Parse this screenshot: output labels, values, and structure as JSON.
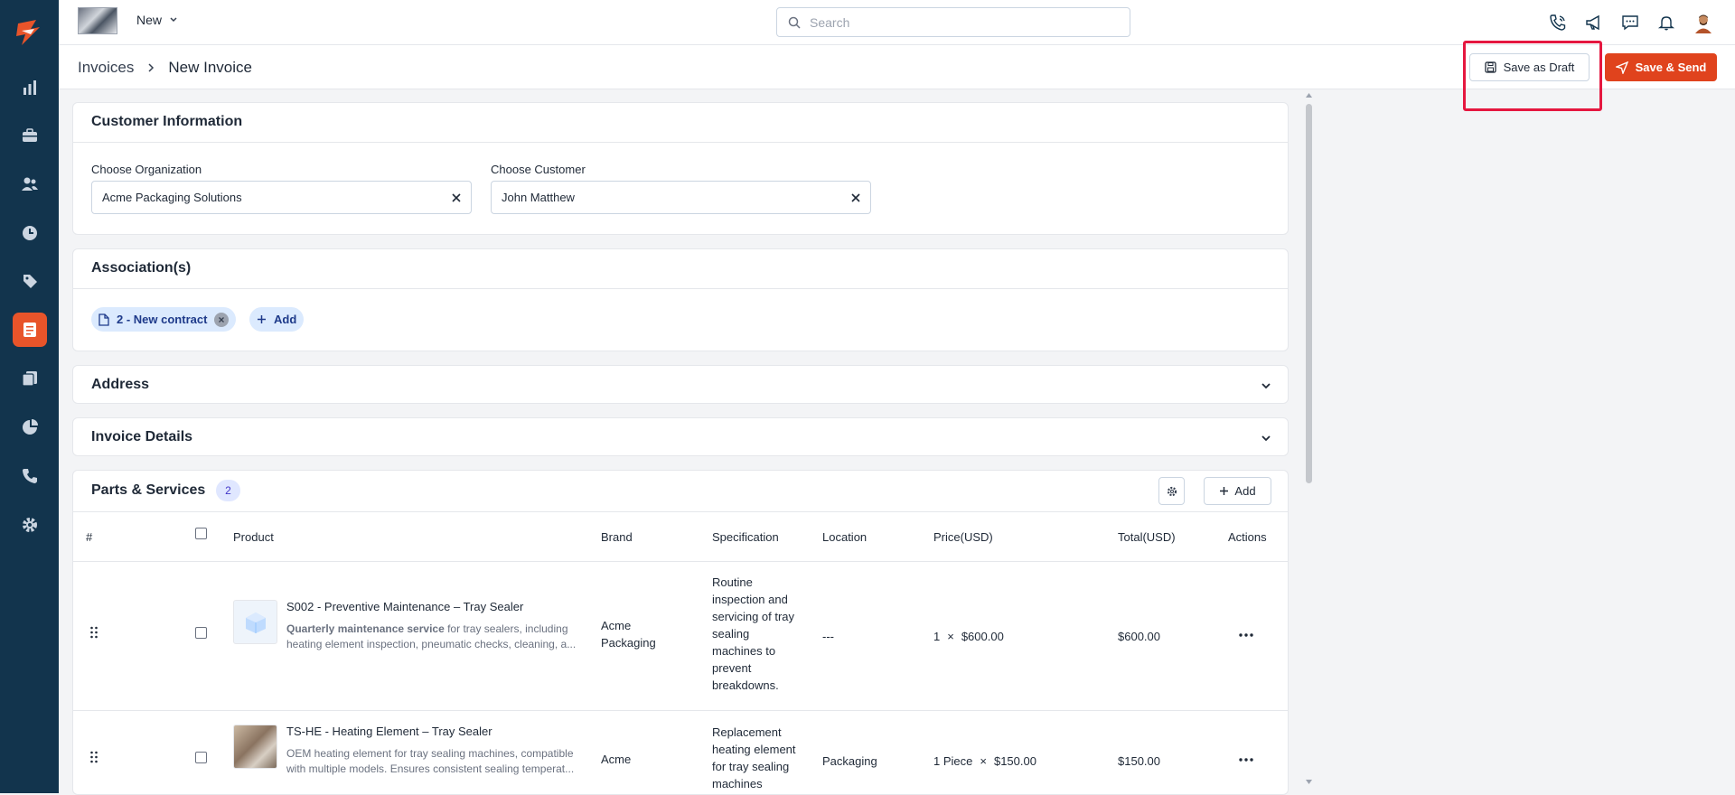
{
  "topbar": {
    "new_label": "New",
    "search_placeholder": "Search"
  },
  "breadcrumb": {
    "parent": "Invoices",
    "current": "New Invoice"
  },
  "actions": {
    "save_draft": "Save as Draft",
    "save_send": "Save & Send"
  },
  "customer_info": {
    "title": "Customer Information",
    "org_label": "Choose Organization",
    "org_value": "Acme Packaging Solutions",
    "customer_label": "Choose Customer",
    "customer_value": "John Matthew"
  },
  "associations": {
    "title": "Association(s)",
    "chip_label": "2 - New contract",
    "add_label": "Add"
  },
  "address": {
    "title": "Address"
  },
  "invoice_details": {
    "title": "Invoice Details"
  },
  "parts": {
    "title": "Parts & Services",
    "count": "2",
    "add_label": "Add",
    "columns": {
      "num": "#",
      "product": "Product",
      "brand": "Brand",
      "spec": "Specification",
      "location": "Location",
      "price": "Price(USD)",
      "total": "Total(USD)",
      "actions": "Actions"
    },
    "rows": [
      {
        "name": "S002 - Preventive Maintenance – Tray Sealer",
        "desc_bold": "Quarterly maintenance service",
        "desc_rest": " for tray sealers, including heating element inspection, pneumatic checks, cleaning, a...",
        "brand": "Acme Packaging",
        "spec": "Routine inspection and servicing of tray sealing machines to prevent breakdowns.",
        "location": "---",
        "qty": "1",
        "unit_price": "$600.00",
        "total": "$600.00"
      },
      {
        "name": "TS-HE - Heating Element – Tray Sealer",
        "desc_bold": "",
        "desc_rest": "OEM heating element for tray sealing machines, compatible with multiple models. Ensures consistent sealing temperat...",
        "brand": "Acme",
        "spec": "Replacement heating element for tray sealing machines",
        "location": "Packaging",
        "qty": "1 Piece",
        "unit_price": "$150.00",
        "total": "$150.00"
      }
    ]
  },
  "sidebar": {
    "items": [
      "logo-icon",
      "analytics-icon",
      "deals-icon",
      "contacts-icon",
      "activities-icon",
      "products-icon",
      "invoices-icon",
      "documents-icon",
      "reports-icon",
      "phone-icon",
      "settings-icon"
    ],
    "active": "invoices-icon"
  },
  "colors": {
    "sidebar": "#12344d",
    "accent": "#e0431d",
    "highlight": "#e5173f"
  }
}
